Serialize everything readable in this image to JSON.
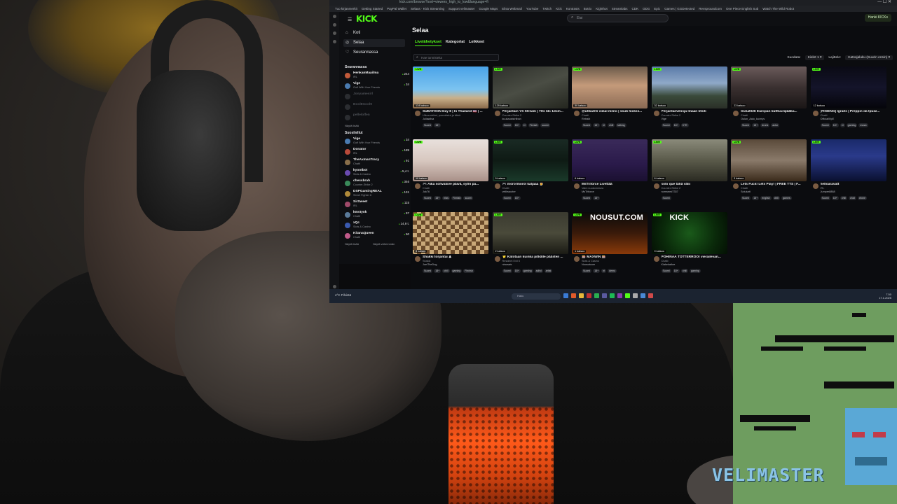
{
  "browser": {
    "url": "kick.com/browse?sort=viewers_high_to_low&language=fi",
    "window_controls": "—  ☐  ✕",
    "bookmarks": [
      "Tuo kirjanmerkit",
      "Getting Started",
      "PayPal Wallet",
      "Selaus · Kick Streaming",
      "Support velimaster",
      "Google Maps",
      "Elisa Webmail",
      "YouTube",
      "Twitch",
      "Kick",
      "Kontrasts",
      "Botrix",
      "Kighthot",
      "Streamlabs",
      "CDK",
      "ODG",
      "Epic",
      "Games | GGDetected",
      "Revsproundcom",
      "One Piece English Sub",
      "Watch The Wild Robot"
    ]
  },
  "header": {
    "logo": "KICK",
    "search_placeholder": "Etsi",
    "user_label": "Hanki KICKs"
  },
  "sidebar": {
    "nav": [
      {
        "label": "Koti",
        "icon": "home-icon"
      },
      {
        "label": "Selaa",
        "icon": "compass-icon"
      },
      {
        "label": "Seurannassa",
        "icon": "heart-icon"
      }
    ],
    "following_title": "Seurannassa",
    "following": [
      {
        "name": "HenkanMaailma",
        "game": "IRL",
        "viewers": "244",
        "color": "#c25a3a"
      },
      {
        "name": "Vige",
        "game": "Golf With Your Friends",
        "viewers": "34",
        "color": "#4a7bb0"
      },
      {
        "name": "Jonyamesirl",
        "game": "",
        "viewers": "",
        "offline": true
      },
      {
        "name": "Bool8Gool9",
        "game": "",
        "viewers": "",
        "offline": true
      },
      {
        "name": "pellelolfen",
        "game": "",
        "viewers": "",
        "offline": true
      }
    ],
    "following_more": "Näytä lisää",
    "recommended_title": "Suositellut",
    "recommended": [
      {
        "name": "Vige",
        "game": "Golf With Your Friends",
        "viewers": "34",
        "color": "#4a7bb0"
      },
      {
        "name": "Donator",
        "game": "IRL",
        "viewers": "189",
        "color": "#b94a3a"
      },
      {
        "name": "TheAxmanTracy",
        "game": "Chatti",
        "viewers": "91",
        "color": "#8a6f4a"
      },
      {
        "name": "kyootbot",
        "game": "Slots & Casino",
        "viewers": "5,4 t.",
        "color": "#6a4ab0"
      },
      {
        "name": "chessbrah",
        "game": "Counter-Strike 2",
        "viewers": "346",
        "color": "#3a8a5a"
      },
      {
        "name": "DSPGamingREAL",
        "game": "Street Fighter 6",
        "viewers": "131",
        "color": "#b08a3a"
      },
      {
        "name": "SirSweet",
        "game": "IRL",
        "viewers": "115",
        "color": "#a04a6a"
      },
      {
        "name": "kmstynk",
        "game": "Chatti",
        "viewers": "97",
        "color": "#5a7a9a"
      },
      {
        "name": "xQc",
        "game": "Slots & Casino",
        "viewers": "14,9 t.",
        "color": "#3a5ab0"
      },
      {
        "name": "KitanaQueen",
        "game": "Chatti",
        "viewers": "50",
        "color": "#c05a8a"
      }
    ],
    "recommended_more": "Näytä lisää",
    "recommended_less": "Näytä vähemmän"
  },
  "main": {
    "title": "Selaa",
    "tabs": [
      "Livelähetykset",
      "Kategoriat",
      "Leikkeet"
    ],
    "filter_placeholder": "Hae tunnisteita",
    "filter_label": "Suodata:",
    "languages_label": "Kielet",
    "languages_count": "1",
    "sort_label": "Lajittele:",
    "sort_value": "Katsojaluku (Suurin ensin)",
    "live_label": "LIVE",
    "cards": [
      {
        "viewers": "134 katsoo",
        "title": "SUBATHON Day 8 | In Thailand 🇹🇭 | ...",
        "category": "Ulkoa-striimi, pomottelut ja kikkit",
        "channel": "Jullawilsa",
        "tags": [
          "Suomi",
          "18+"
        ],
        "bg": "linear-gradient(180deg,#4aa3e8 0%,#7cc3f0 55%,#c9b08a 75%,#8a6a4a 100%)"
      },
      {
        "viewers": "129 katsoo",
        "title": "Perjantain YS Stream | Ylts ldc 1dcm...",
        "category": "Counter-Strike 2",
        "channel": "kuukausistriiban",
        "tags": [
          "Suomi",
          "18+",
          "irl",
          "Finnish",
          "suomi"
        ],
        "bg": "linear-gradient(160deg,#2d2f2a 0%,#4a4d44 50%,#24261f 100%)"
      },
      {
        "viewers": "50 katsoo",
        "title": "@uhkaOG viikal meno | 1sub hickss...",
        "category": "Chatti",
        "channel": "Retrakt",
        "tags": [
          "Suomi",
          "18+",
          "irl",
          "chill",
          "talking"
        ],
        "bg": "linear-gradient(180deg,#6a5a4a 0%,#c49a7a 45%,#8a6a54 100%)"
      },
      {
        "viewers": "32 katsoo",
        "title": "Perjantai/vensja lmaan litsiti",
        "category": "Counter-Strike 2",
        "channel": "Vige",
        "tags": [
          "Suomi",
          "18+",
          "KTE"
        ],
        "bg": "linear-gradient(180deg,#5a7aa8 0%,#8fa9c8 40%,#3a4a3a 70%,#2a2f28 100%)"
      },
      {
        "viewers": "23 katsoo",
        "title": "Oulu2026 Europan kulttuuripääka...",
        "category": "Chatti",
        "channel": "Oulun_Aalo_kuvrrys",
        "tags": [
          "Suomi",
          "18+",
          "drunk",
          "actor"
        ],
        "bg": "linear-gradient(180deg,#6a5a5a 0%,#3a3030 50%,#1a1616 100%)"
      },
      {
        "viewers": "12 katsoo",
        "title": "[FIN/ENG] Igraits | Preppin da tpuzz...",
        "category": "Chatti",
        "channel": "OfficialWpE",
        "tags": [
          "Suomi",
          "18+",
          "irl",
          "gaming",
          "music"
        ],
        "bg": "linear-gradient(180deg,#0a0a14 0%,#14142a 50%,#05050a 100%)"
      },
      {
        "viewers": "10 katsoo",
        "title": "🎮 Aika sohvaliive päivä, syön pa...",
        "category": "Chatti",
        "channel": "Juk76",
        "tags": [
          "Suomi",
          "18+",
          "irlas",
          "Finnish",
          "suomi"
        ],
        "bg": "linear-gradient(180deg,#e8e0dc 0%,#d8c8c0 50%,#a89088 100%)"
      },
      {
        "viewers": "9 katsoo",
        "title": "🎮 morormorol kaljaaa 🍺",
        "category": "Chatti",
        "channel": "velileacoter",
        "tags": [
          "Suomi",
          "18+"
        ],
        "bg": "linear-gradient(180deg,#1a2a24 0%,#0e1a14 50%,#1a3a2a 100%)"
      },
      {
        "viewers": "6 katsoo",
        "title": "MsTriforce Livettää",
        "category": "Valm nuukomesea",
        "channel": "MsTriforce",
        "tags": [
          "Suomi",
          "18+"
        ],
        "bg": "linear-gradient(180deg,#3a2a5a 0%,#2a1a4a 60%,#1a1030 100%)"
      },
      {
        "viewers": "6 katsoo",
        "title": "solo que tähä välii",
        "category": "Counter-Strike 2",
        "channel": "norrweed7337",
        "tags": [
          "Suomi"
        ],
        "bg": "linear-gradient(180deg,#8a8a7a 0%,#5a5a4a 50%,#2a2a22 100%)"
      },
      {
        "viewers": "3 katsoo",
        "title": "Lets Fuck! Lets Play! | FREE TTS | F...",
        "category": "Chatti",
        "channel": "Solukatt",
        "tags": [
          "Suomi",
          "18+",
          "english",
          "chill",
          "games"
        ],
        "bg": "linear-gradient(180deg,#5a4a3a 0%,#8a7a6a 50%,#3a2a1a 100%)"
      },
      {
        "viewers": "",
        "title": "helloaravatt",
        "category": "IRL",
        "channel": "Jumper8888",
        "tags": [
          "Suomi",
          "18+",
          "chill",
          "chat",
          "drone"
        ],
        "bg": "linear-gradient(180deg,#1a2a6a 0%,#2a3a8a 40%,#0a1030 100%)"
      },
      {
        "viewers": "3 katsoo",
        "title": "Shakki torjantai ♟",
        "category": "Shakki",
        "channel": "JoelTheDog",
        "tags": [
          "Suomi",
          "18+",
          "chill",
          "gaming",
          "Finnish"
        ],
        "bg": "repeating-conic-gradient(#c8a878 0% 25%, #6a4a2a 0% 50%) 0 0/12px 12px"
      },
      {
        "viewers": "2 katsoo",
        "title": "⭐ Katotaan kuinka pitkälle päästen ...",
        "category": "Resident Evil 5",
        "channel": "nirwaais",
        "tags": [
          "Suomi",
          "18+",
          "gaming",
          "adhd",
          "artist"
        ],
        "bg": "linear-gradient(180deg,#3a3a30 0%,#4a4a3a 50%,#1a1a14 100%)"
      },
      {
        "viewers": "1 katsoo",
        "title": "🎰 MAXWIN 🎰",
        "category": "Slots & Casino",
        "channel": "Nousutcom",
        "tags": [
          "Suomi",
          "18+",
          "irl",
          "demo"
        ],
        "bg": "linear-gradient(180deg,#0a0a0a 0%,#3a1a0a 50%,#8a3a0a 100%)",
        "banner": "NOUSUT.COM"
      },
      {
        "viewers": "0 katsoo",
        "title": "PÖHINÄÄ TÖTTERRÖÖ! vierailevan...",
        "category": "Chatti",
        "channel": "Kiakekatkre",
        "tags": [
          "Suomi",
          "18+",
          "chill",
          "gaming"
        ],
        "bg": "radial-gradient(circle at 50% 50%,#1a5a1a 0%,#0a2a0a 60%,#041004 100%)",
        "banner": "KICK"
      }
    ]
  },
  "taskbar": {
    "weather": "4°C Pilvistä",
    "search": "Haku",
    "time": "7.50",
    "date": "17.1.2025"
  },
  "overlay": {
    "brand": "VELIMASTER"
  }
}
